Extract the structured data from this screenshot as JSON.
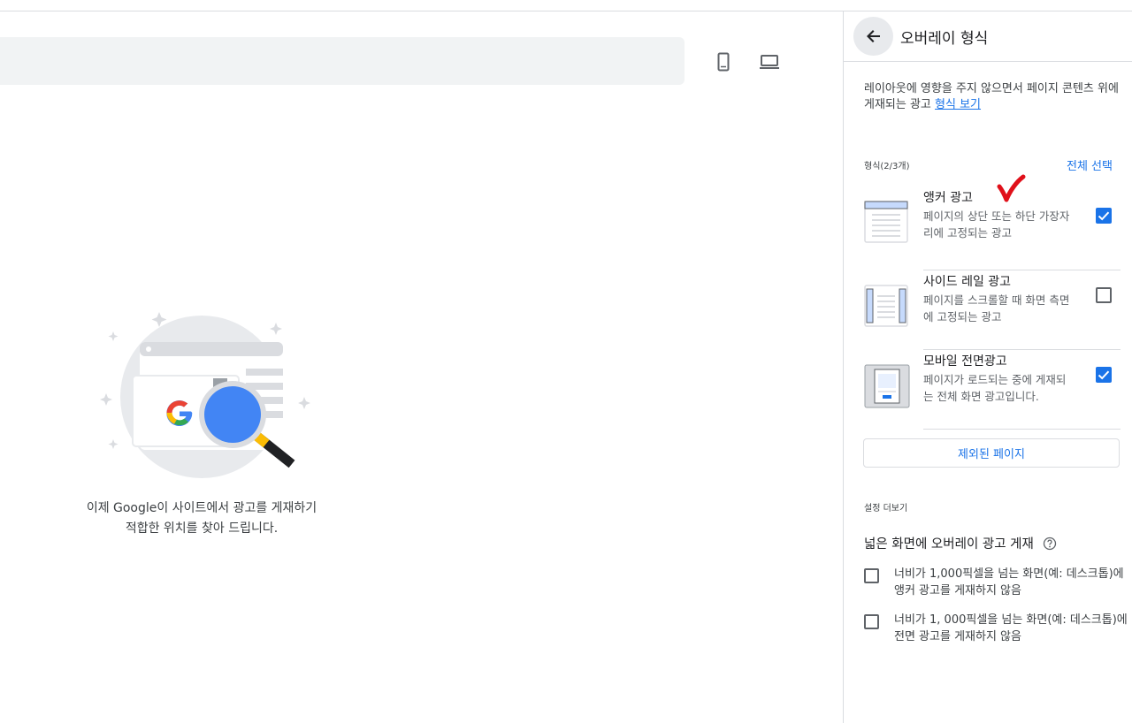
{
  "preview": {
    "device_icons": [
      "mobile-phone-icon",
      "laptop-icon"
    ],
    "caption_lines": [
      "이제 Google이 사이트에서 광고를 게재하기",
      "적합한 위치를 찾아 드립니다."
    ]
  },
  "panel": {
    "title": "오버레이 형식",
    "description_text": "레이아웃에 영향을 주지 않으면서 페이지 콘텐츠 위에 게재되는 광고",
    "description_link": "형식 보기",
    "formats_label": "형식(2/3개)",
    "select_all": "전체 선택",
    "formats": [
      {
        "name": "앵커 광고",
        "line1": "페이지의 상단 또는 하단 가장자",
        "line2": "리에 고정되는 광고",
        "checked": true,
        "icon": "anchor-ad-icon"
      },
      {
        "name": "사이드 레일 광고",
        "line1": "페이지를 스크롤할 때 화면 측면",
        "line2": "에 고정되는 광고",
        "checked": false,
        "icon": "side-rail-ad-icon"
      },
      {
        "name": "모바일 전면광고",
        "line1": "페이지가 로드되는 중에 게재되",
        "line2": "는 전체 화면 광고입니다.",
        "checked": true,
        "icon": "vignette-ad-icon"
      }
    ],
    "excluded_pages_button": "제외된 페이지",
    "more_settings_label": "설정 더보기",
    "wide_screen_title": "넓은 화면에 오버레이 광고 게재",
    "options": [
      {
        "line1": "너비가 1,000픽셀을 넘는 화면(예: 데스크톱)에",
        "line2": "앵커 광고를 게재하지 않음",
        "checked": false
      },
      {
        "line1": "너비가 1, 000픽셀을 넘는 화면(예: 데스크톱)에",
        "line2": "전면 광고를 게재하지 않음",
        "checked": false
      }
    ]
  },
  "colors": {
    "accent": "#1a73e8",
    "annotation_red": "#e0101a"
  }
}
